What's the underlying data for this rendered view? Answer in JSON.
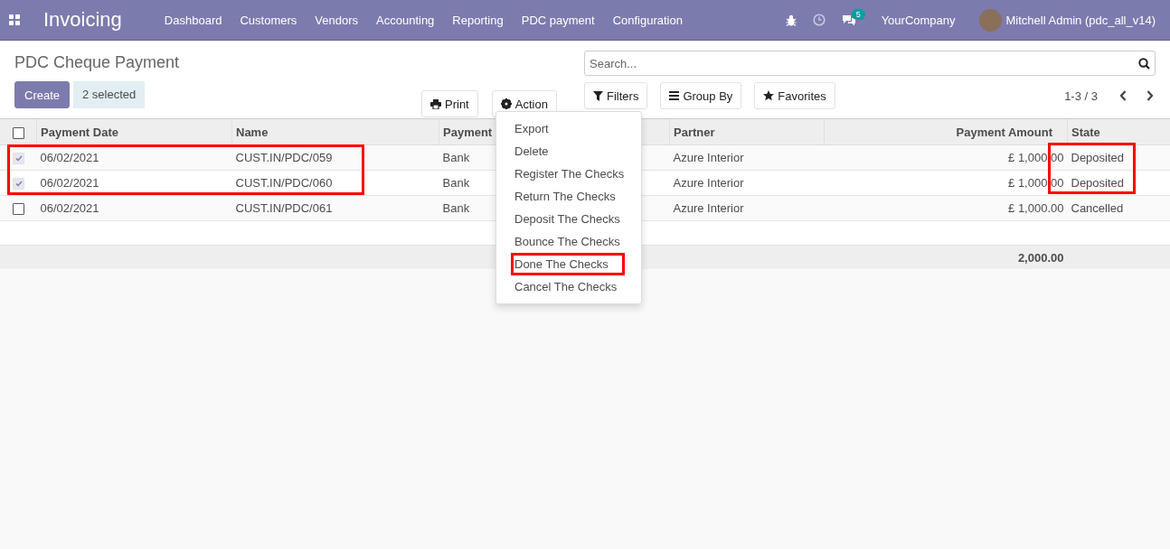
{
  "navbar": {
    "app_name": "Invoicing",
    "menu": [
      "Dashboard",
      "Customers",
      "Vendors",
      "Accounting",
      "Reporting",
      "PDC payment",
      "Configuration"
    ],
    "message_count": "5",
    "company": "YourCompany",
    "user": "Mitchell Admin (pdc_all_v14)"
  },
  "page_title": "PDC Cheque Payment",
  "create_button": "Create",
  "selection_count": "2 selected",
  "print_button": "Print",
  "action_button": "Action",
  "search": {
    "placeholder": "Search..."
  },
  "filters_button": "Filters",
  "group_by_button": "Group By",
  "favorites_button": "Favorites",
  "pager": "1-3 / 3",
  "action_menu": [
    {
      "label": "Export",
      "highlighted": false
    },
    {
      "label": "Delete",
      "highlighted": false
    },
    {
      "label": "Register The Checks",
      "highlighted": false
    },
    {
      "label": "Return The Checks",
      "highlighted": false
    },
    {
      "label": "Deposit The Checks",
      "highlighted": false
    },
    {
      "label": "Bounce The Checks",
      "highlighted": false
    },
    {
      "label": "Done The Checks",
      "highlighted": true
    },
    {
      "label": "Cancel The Checks",
      "highlighted": false
    }
  ],
  "table": {
    "select_all_checked": false,
    "columns": [
      "Payment Date",
      "Name",
      "Payment",
      "Partner",
      "Payment Amount",
      "State"
    ],
    "rows": [
      {
        "checked": true,
        "highlighted": true,
        "state_highlighted": true,
        "cells": [
          "06/02/2021",
          "CUST.IN/PDC/059",
          "Bank",
          "Azure Interior",
          "£ 1,000.00",
          "Deposited"
        ]
      },
      {
        "checked": true,
        "highlighted": true,
        "state_highlighted": true,
        "cells": [
          "06/02/2021",
          "CUST.IN/PDC/060",
          "Bank",
          "Azure Interior",
          "£ 1,000.00",
          "Deposited"
        ]
      },
      {
        "checked": false,
        "highlighted": false,
        "state_highlighted": false,
        "cells": [
          "06/02/2021",
          "CUST.IN/PDC/061",
          "Bank",
          "Azure Interior",
          "£ 1,000.00",
          "Cancelled"
        ]
      }
    ],
    "total": "2,000.00"
  }
}
